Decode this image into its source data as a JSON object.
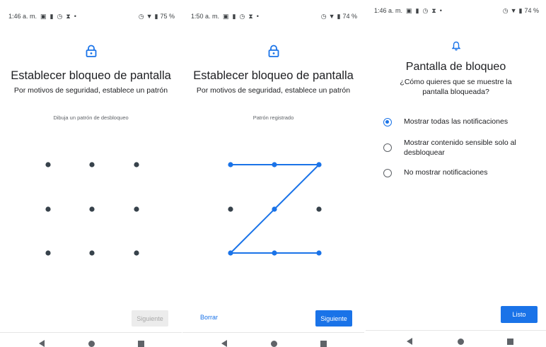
{
  "screen1": {
    "status": {
      "time": "1:46 a. m.",
      "battery": "75 %"
    },
    "title": "Establecer bloqueo de pantalla",
    "subtitle": "Por motivos de seguridad, establece un patrón",
    "hint": "Dibuja un patrón de desbloqueo",
    "next_button": "Siguiente"
  },
  "screen2": {
    "status": {
      "time": "1:50 a. m.",
      "battery": "74 %"
    },
    "title": "Establecer bloqueo de pantalla",
    "subtitle": "Por motivos de seguridad, establece un patrón",
    "hint": "Patrón registrado",
    "clear_button": "Borrar",
    "next_button": "Siguiente",
    "pattern_sequence": [
      1,
      2,
      3,
      5,
      7,
      8,
      9
    ]
  },
  "screen3": {
    "status": {
      "time": "1:46 a. m.",
      "battery": "74 %"
    },
    "title": "Pantalla de bloqueo",
    "subtitle": "¿Cómo quieres que se muestre la pantalla bloqueada?",
    "options": [
      {
        "label": "Mostrar todas las notificaciones",
        "selected": true
      },
      {
        "label": "Mostrar contenido sensible solo al desbloquear",
        "selected": false
      },
      {
        "label": "No mostrar notificaciones",
        "selected": false
      }
    ],
    "done_button": "Listo"
  },
  "colors": {
    "accent": "#1a73e8",
    "dot": "#37424b",
    "disabled_bg": "#ececec",
    "disabled_text": "#a9a9a9"
  },
  "icons": {
    "status_left": [
      "image-icon",
      "sim-icon",
      "alarm-clock-icon",
      "hourglass-icon",
      "dot-icon"
    ],
    "status_right": [
      "alarm-icon",
      "wifi-icon",
      "battery-icon"
    ],
    "header_lock": "lock-icon",
    "header_bell": "bell-icon",
    "nav": [
      "back-icon",
      "home-icon",
      "recents-icon"
    ]
  }
}
